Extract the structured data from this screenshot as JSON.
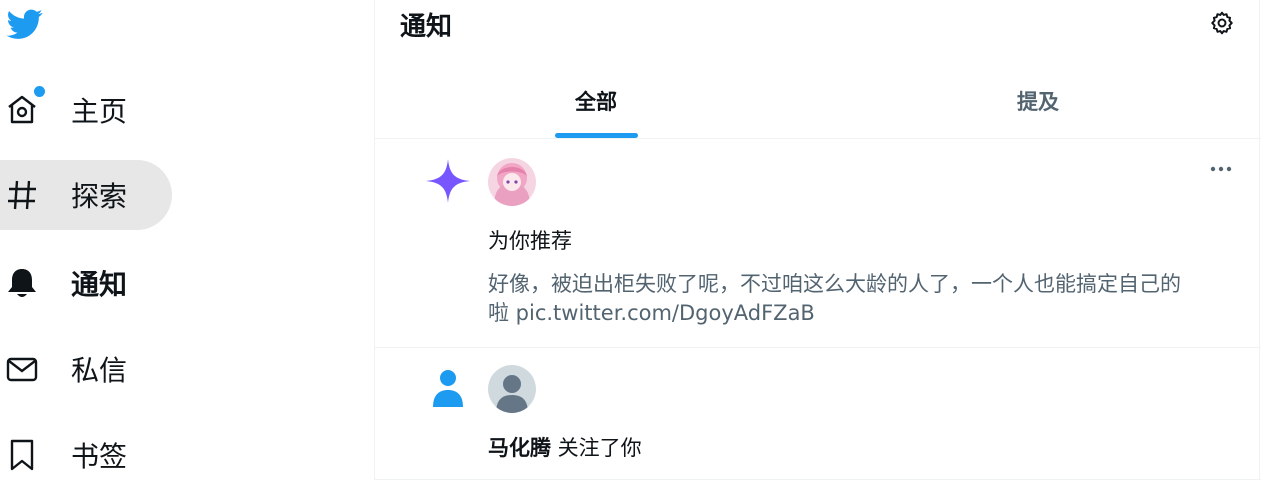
{
  "colors": {
    "accent": "#1d9bf0",
    "spark": "#7856ff",
    "text": "#0f1419",
    "secondary": "#536471"
  },
  "sidebar": {
    "logo_icon": "twitter-bird-icon",
    "items": [
      {
        "label": "主页",
        "icon": "home-icon",
        "has_unread_dot": true
      },
      {
        "label": "探索",
        "icon": "hashtag-icon",
        "hovered": true
      },
      {
        "label": "通知",
        "icon": "bell-icon",
        "active": true
      },
      {
        "label": "私信",
        "icon": "envelope-icon"
      },
      {
        "label": "书签",
        "icon": "bookmark-icon"
      }
    ]
  },
  "header": {
    "title": "通知",
    "settings_icon": "gear-icon"
  },
  "tabs": [
    {
      "label": "全部",
      "active": true
    },
    {
      "label": "提及",
      "active": false
    }
  ],
  "notifications": [
    {
      "type_icon": "sparkle-icon",
      "title": "为你推荐",
      "body_line1": "好像，被迫出柜失败了呢，不过咱这么大龄的人了，一个人也能搞定自己的",
      "body_line2": "啦 pic.twitter.com/DgoyAdFZaB",
      "more_icon": "more-icon"
    },
    {
      "type_icon": "person-icon",
      "user_name": "马化腾",
      "action": " 关注了你"
    }
  ]
}
